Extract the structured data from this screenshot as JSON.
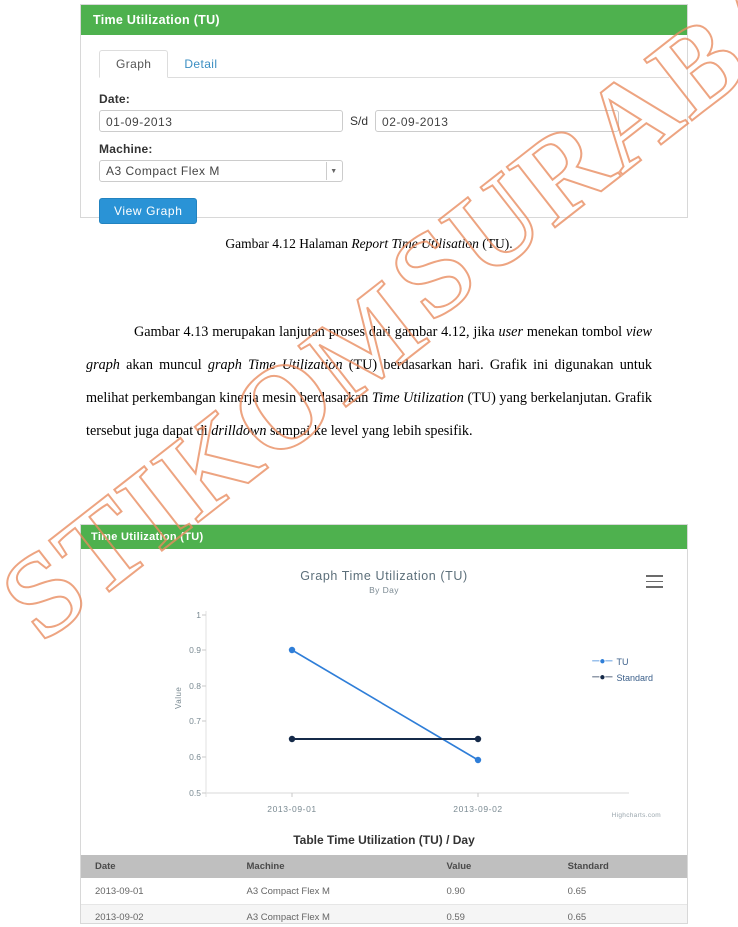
{
  "figure_form": {
    "header": "Time Utilization (TU)",
    "tabs": [
      {
        "label": "Graph",
        "active": true
      },
      {
        "label": "Detail",
        "active": false
      }
    ],
    "date_label": "Date:",
    "date_from": "01-09-2013",
    "sd_label": "S/d",
    "date_to": "02-09-2013",
    "machine_label": "Machine:",
    "machine_value": "A3 Compact Flex M",
    "view_graph_button": "View Graph"
  },
  "caption": {
    "prefix": "Gambar 4.12 Halaman ",
    "italic": "Report Time Utilisation",
    "suffix": " (TU)."
  },
  "paragraph": {
    "p1_a": "Gambar 4.13 merupakan lanjutan proses dari gambar 4.12, jika ",
    "p1_i1": "user",
    "p1_b": " menekan tombol ",
    "p1_i2": "view graph",
    "p1_c": " akan muncul ",
    "p1_i3": "graph Time Utilization",
    "p1_d": " (TU) berdasarkan hari. Grafik ini digunakan untuk melihat perkembangan kinerja mesin berdasarkan ",
    "p1_i4": "Time Utilization",
    "p1_e": " (TU) yang berkelanjutan. Grafik tersebut juga dapat di ",
    "p1_i5": "drilldown",
    "p1_f": " sampai ke level yang lebih spesifik."
  },
  "figure_chart": {
    "header": "Time Utilization (TU)",
    "menu_icon": "hamburger-menu-icon",
    "credit": "Highcharts.com",
    "table_title": "Table Time Utilization (TU) / Day",
    "table_headers": [
      "Date",
      "Machine",
      "Value",
      "Standard"
    ],
    "table_rows": [
      [
        "2013-09-01",
        "A3 Compact Flex M",
        "0.90",
        "0.65"
      ],
      [
        "2013-09-02",
        "A3 Compact Flex M",
        "0.59",
        "0.65"
      ]
    ]
  },
  "chart_data": {
    "type": "line",
    "title": "Graph Time Utilization (TU)",
    "subtitle": "By Day",
    "xlabel": "",
    "ylabel": "Value",
    "categories": [
      "2013-09-01",
      "2013-09-02"
    ],
    "yticks": [
      "0.5",
      "0.6",
      "0.7",
      "0.8",
      "0.9",
      "1"
    ],
    "ylim": [
      0.5,
      1.0
    ],
    "grid": false,
    "legend_position": "right",
    "series": [
      {
        "name": "TU",
        "values": [
          0.9,
          0.59
        ],
        "color": "#2f7ed8",
        "marker": "circle"
      },
      {
        "name": "Standard",
        "values": [
          0.65,
          0.65
        ],
        "color": "#1a2b4a",
        "marker": "circle"
      }
    ]
  },
  "watermark": {
    "line1": "STIKOM",
    "line2": "SURABAYA"
  }
}
